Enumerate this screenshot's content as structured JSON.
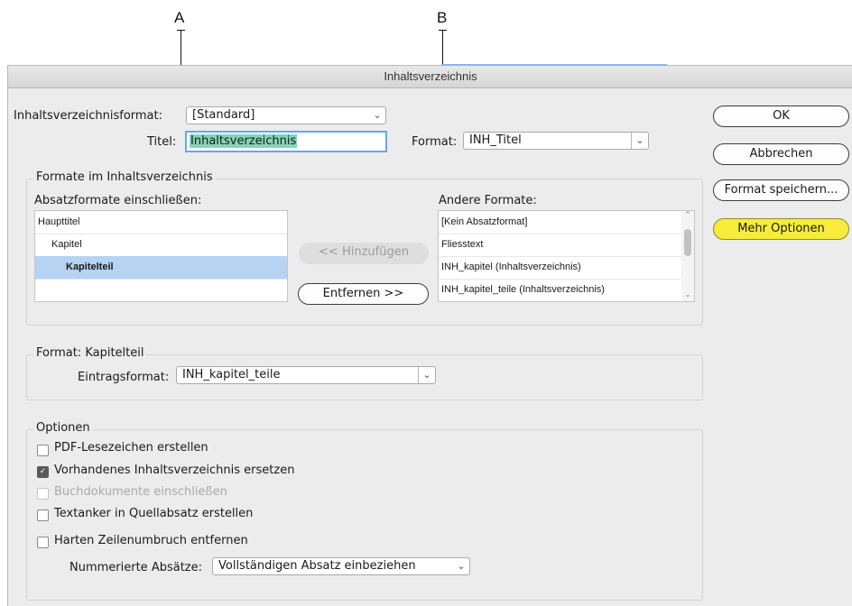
{
  "callouts": {
    "a": "A",
    "b": "B"
  },
  "dialog": {
    "title": "Inhaltsverzeichnis",
    "toc_format": {
      "label": "Inhaltsverzeichnisformat:",
      "value": "[Standard]"
    },
    "titel": {
      "label": "Titel:",
      "value": "Inhaltsverzeichnis"
    },
    "format": {
      "label": "Format:",
      "value": "INH_Titel"
    },
    "buttons": {
      "ok": "OK",
      "cancel": "Abbrechen",
      "save_format": "Format speichern...",
      "more_options": "Mehr Optionen"
    },
    "formats_group": {
      "title": "Formate im Inhaltsverzeichnis",
      "include_label": "Absatzformate einschließen:",
      "included": [
        "Haupttitel",
        "Kapitel",
        "Kapitelteil"
      ],
      "selected_index": 2,
      "add_button": "<< Hinzufügen",
      "remove_button": "Entfernen >>",
      "other_label": "Andere Formate:",
      "other": [
        "[Kein Absatzformat]",
        "Fliesstext",
        "INH_kapitel (Inhaltsverzeichnis)",
        "INH_kapitel_teile (Inhaltsverzeichnis)"
      ]
    },
    "style_group": {
      "title": "Format: Kapitelteil",
      "entry_label": "Eintragsformat:",
      "entry_value": "INH_kapitel_teile"
    },
    "options_group": {
      "title": "Optionen",
      "checkboxes": [
        {
          "label": "PDF-Lesezeichen erstellen",
          "checked": false,
          "enabled": true
        },
        {
          "label": "Vorhandenes Inhaltsverzeichnis ersetzen",
          "checked": true,
          "enabled": true
        },
        {
          "label": "Buchdokumente einschließen",
          "checked": false,
          "enabled": false
        },
        {
          "label": "Textanker in Quellabsatz erstellen",
          "checked": false,
          "enabled": true
        },
        {
          "label": "Harten Zeilenumbruch entfernen",
          "checked": false,
          "enabled": true
        }
      ],
      "numbered_label": "Nummerierte Absätze:",
      "numbered_value": "Vollständigen Absatz einbeziehen"
    }
  },
  "colors": {
    "highlight": "#f7ec3a",
    "selection": "#b6d3f3",
    "title_selection": "#82d6b5",
    "focus_ring": "#6aa6ea"
  }
}
